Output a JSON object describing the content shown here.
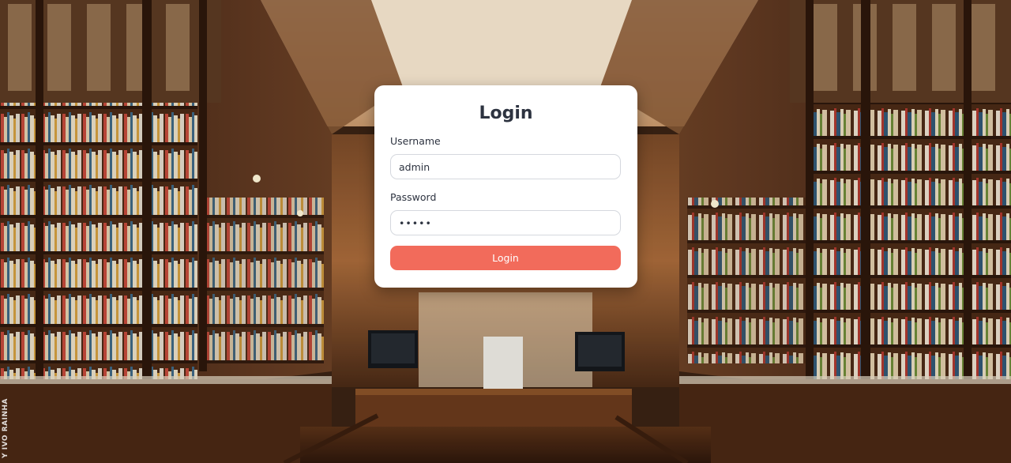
{
  "background": {
    "description_icon": "bookstore-interior-photo",
    "photo_credit": "Y IVO RAINHA"
  },
  "login": {
    "title": "Login",
    "username_label": "Username",
    "username_value": "admin",
    "password_label": "Password",
    "password_value": "admin",
    "button_label": "Login"
  },
  "colors": {
    "button": "#f26b5b",
    "card": "#ffffff",
    "text": "#2d3340"
  }
}
